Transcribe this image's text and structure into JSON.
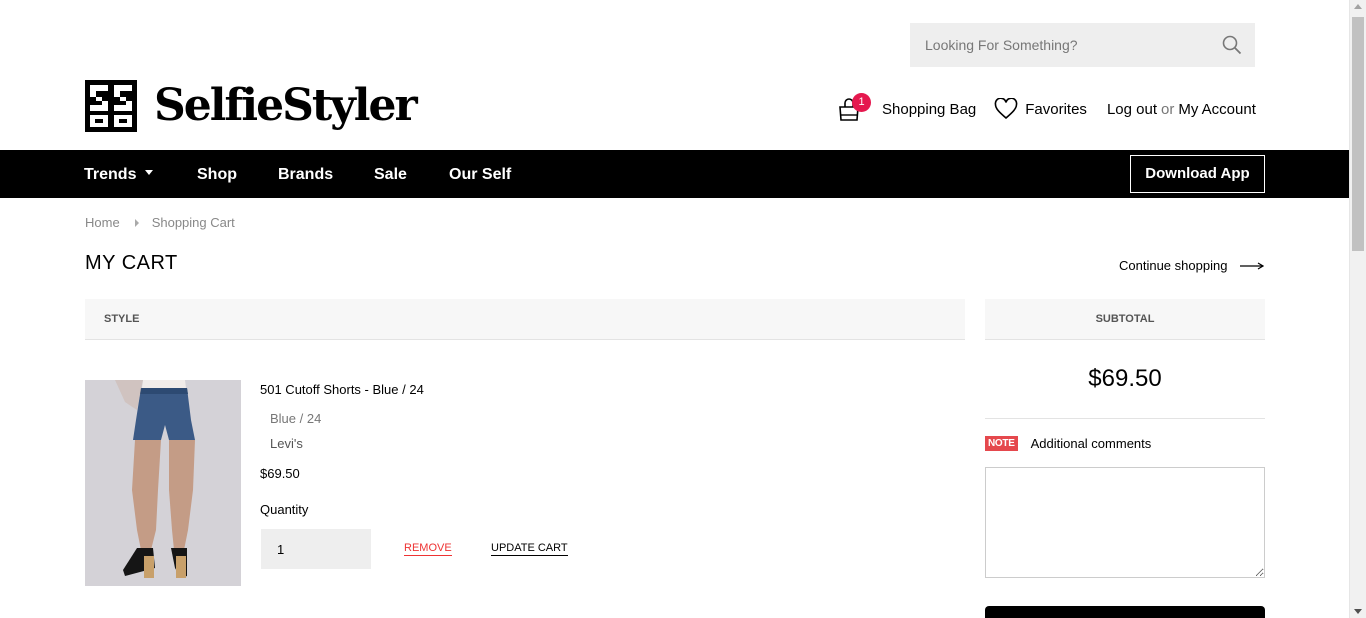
{
  "search": {
    "placeholder": "Looking For Something?"
  },
  "brand": {
    "name": "SelfieStyler"
  },
  "account": {
    "bag_count": "1",
    "bag_label": "Shopping Bag",
    "favorites_label": "Favorites",
    "logout_label": "Log out",
    "or_label": "or",
    "account_label": "My Account"
  },
  "nav": {
    "items": [
      "Trends",
      "Shop",
      "Brands",
      "Sale",
      "Our Self"
    ],
    "download_app": "Download App"
  },
  "breadcrumb": {
    "home": "Home",
    "current": "Shopping Cart"
  },
  "page": {
    "title": "MY CART",
    "continue": "Continue shopping"
  },
  "table": {
    "style_header": "STYLE",
    "subtotal_header": "SUBTOTAL"
  },
  "product": {
    "title": "501 Cutoff Shorts - Blue / 24",
    "variant": "Blue / 24",
    "brand": "Levi's",
    "price": "$69.50",
    "quantity_label": "Quantity",
    "quantity_value": "1",
    "remove_label": "REMOVE",
    "update_label": "UPDATE CART"
  },
  "summary": {
    "subtotal": "$69.50",
    "note_badge": "NOTE",
    "note_label": "Additional comments"
  },
  "colors": {
    "accent": "#e5184e",
    "remove": "#e33333",
    "note": "#e5484d"
  }
}
